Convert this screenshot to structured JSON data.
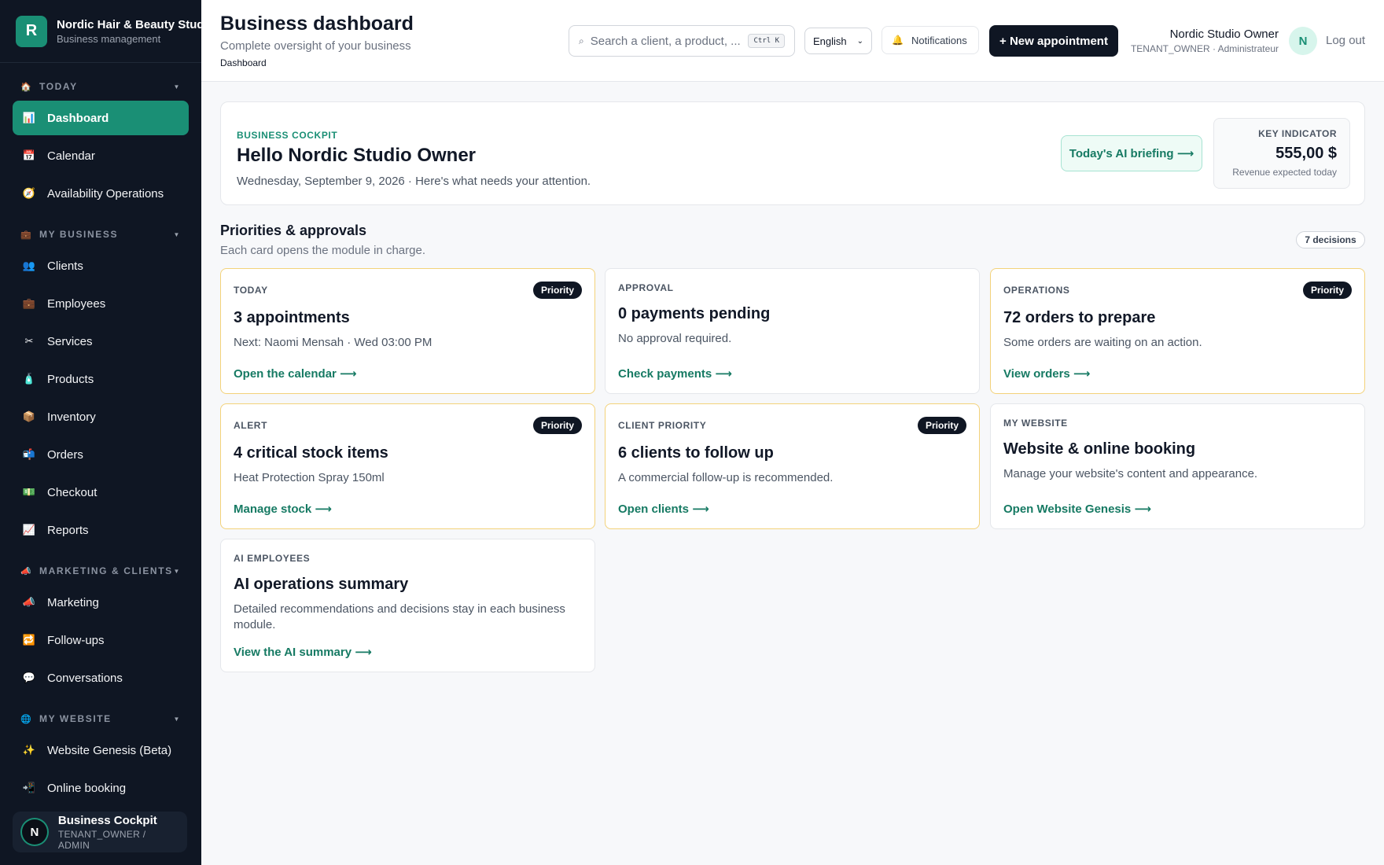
{
  "brand": {
    "logo_letter": "R",
    "name": "Nordic Hair & Beauty Studio",
    "subtitle": "Business management"
  },
  "sidebar": {
    "sections": [
      {
        "label": "TODAY",
        "icon": "house-icon",
        "items": [
          {
            "label": "Dashboard",
            "icon": "bar-chart-icon",
            "active": true
          },
          {
            "label": "Calendar",
            "icon": "calendar-icon"
          },
          {
            "label": "Availability Operations",
            "icon": "compass-icon"
          }
        ]
      },
      {
        "label": "MY BUSINESS",
        "icon": "briefcase-icon",
        "items": [
          {
            "label": "Clients",
            "icon": "people-icon"
          },
          {
            "label": "Employees",
            "icon": "briefcase-icon"
          },
          {
            "label": "Services",
            "icon": "scissors-icon"
          },
          {
            "label": "Products",
            "icon": "bottle-icon"
          },
          {
            "label": "Inventory",
            "icon": "box-icon"
          },
          {
            "label": "Orders",
            "icon": "mailbox-icon"
          },
          {
            "label": "Checkout",
            "icon": "cash-icon"
          },
          {
            "label": "Reports",
            "icon": "line-chart-icon"
          }
        ]
      },
      {
        "label": "MARKETING & CLIENTS",
        "icon": "megaphone-icon",
        "items": [
          {
            "label": "Marketing",
            "icon": "megaphone-icon"
          },
          {
            "label": "Follow-ups",
            "icon": "repeat-icon"
          },
          {
            "label": "Conversations",
            "icon": "speech-bubble-icon"
          }
        ]
      },
      {
        "label": "MY WEBSITE",
        "icon": "globe-icon",
        "items": [
          {
            "label": "Website Genesis (Beta)",
            "icon": "sparkles-icon"
          },
          {
            "label": "Online booking",
            "icon": "booking-icon"
          }
        ]
      }
    ],
    "user_card": {
      "avatar_letter": "N",
      "name": "Business Cockpit",
      "role": "TENANT_OWNER / ADMIN"
    }
  },
  "header": {
    "title": "Business dashboard",
    "subtitle": "Complete oversight of your business",
    "breadcrumb": "Dashboard",
    "search_placeholder": "Search a client, a product, ...",
    "search_shortcut": "Ctrl K",
    "language": "English",
    "notifications_label": "Notifications",
    "new_appointment_label": "+ New appointment",
    "user_name": "Nordic Studio Owner",
    "user_role": "TENANT_OWNER · Administrateur",
    "avatar_letter": "N",
    "logout_label": "Log out"
  },
  "cockpit": {
    "eyebrow": "BUSINESS COCKPIT",
    "greeting": "Hello Nordic Studio Owner",
    "date_line": "Wednesday, September 9, 2026 · Here's what needs your attention.",
    "ai_briefing_label": "Today's AI briefing ⟶",
    "key_indicator": {
      "label": "KEY INDICATOR",
      "value": "555,00 $",
      "caption": "Revenue expected today"
    }
  },
  "priorities": {
    "title": "Priorities & approvals",
    "subtitle": "Each card opens the module in charge.",
    "count_badge": "7 decisions",
    "cards": [
      {
        "eyebrow": "TODAY",
        "badge": "Priority",
        "title": "3 appointments",
        "desc": "Next: Naomi Mensah · Wed 03:00 PM",
        "link": "Open the calendar ⟶"
      },
      {
        "eyebrow": "APPROVAL",
        "badge": "",
        "title": "0 payments pending",
        "desc": "No approval required.",
        "link": "Check payments ⟶"
      },
      {
        "eyebrow": "OPERATIONS",
        "badge": "Priority",
        "title": "72 orders to prepare",
        "desc": "Some orders are waiting on an action.",
        "link": "View orders ⟶"
      },
      {
        "eyebrow": "ALERT",
        "badge": "Priority",
        "title": "4 critical stock items",
        "desc": "Heat Protection Spray 150ml",
        "link": "Manage stock ⟶"
      },
      {
        "eyebrow": "CLIENT PRIORITY",
        "badge": "Priority",
        "title": "6 clients to follow up",
        "desc": "A commercial follow-up is recommended.",
        "link": "Open clients ⟶"
      },
      {
        "eyebrow": "MY WEBSITE",
        "badge": "",
        "title": "Website & online booking",
        "desc": "Manage your website's content and appearance.",
        "link": "Open Website Genesis ⟶"
      },
      {
        "eyebrow": "AI EMPLOYEES",
        "badge": "",
        "title": "AI operations summary",
        "desc": "Detailed recommendations and decisions stay in each business module.",
        "link": "View the AI summary ⟶"
      }
    ]
  }
}
